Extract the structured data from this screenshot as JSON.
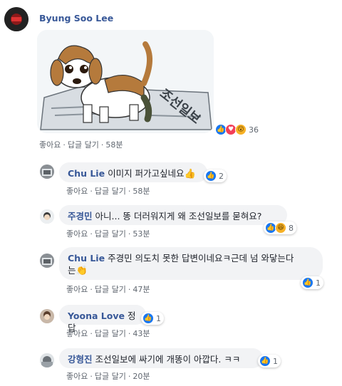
{
  "post": {
    "author": "Byung Soo Lee",
    "reactions": {
      "types": [
        "like-icon",
        "love-icon",
        "wow-icon"
      ],
      "count": "36"
    },
    "actions": {
      "like": "좋아요",
      "reply": "답글 달기",
      "time": "58분"
    },
    "sep": "·"
  },
  "replies": [
    {
      "author": "Chu Lie",
      "text": "이미지 퍼가고싶네요",
      "emoji": "👍",
      "react_types": [
        "like-icon"
      ],
      "react_count": "2",
      "like": "좋아요",
      "reply": "답글 달기",
      "time": "58분"
    },
    {
      "author": "주경민",
      "text": "아니... 똥 더러워지게 왜 조선일보를 묻혀요?",
      "react_types": [
        "like-icon",
        "haha-icon"
      ],
      "react_count": "8",
      "like": "좋아요",
      "reply": "답글 달기",
      "time": "53분"
    },
    {
      "author": "Chu Lie",
      "text": "주경민 의도치 못한 답변이네요ㅋ근데 넘 와닿는다",
      "text2": "는",
      "emoji": "👏",
      "react_types": [
        "like-icon"
      ],
      "react_count": "1",
      "like": "좋아요",
      "reply": "답글 달기",
      "time": "47분"
    },
    {
      "author": "Yoona Love",
      "text": "정답",
      "react_types": [
        "like-icon"
      ],
      "react_count": "1",
      "like": "좋아요",
      "reply": "답글 달기",
      "time": "43분"
    },
    {
      "author": "강형진",
      "text": "조선일보에 싸기에 개똥이 아깝다. ㅋㅋ",
      "react_types": [
        "like-icon"
      ],
      "react_count": "1",
      "like": "좋아요",
      "reply": "답글 달기",
      "time": "20분"
    }
  ],
  "image_sign_text": "조선일보",
  "colors": {
    "link": "#385898",
    "bubble": "#f2f3f5",
    "like": "#1877f2",
    "love": "#f33e58",
    "wow": "#f7b125"
  }
}
